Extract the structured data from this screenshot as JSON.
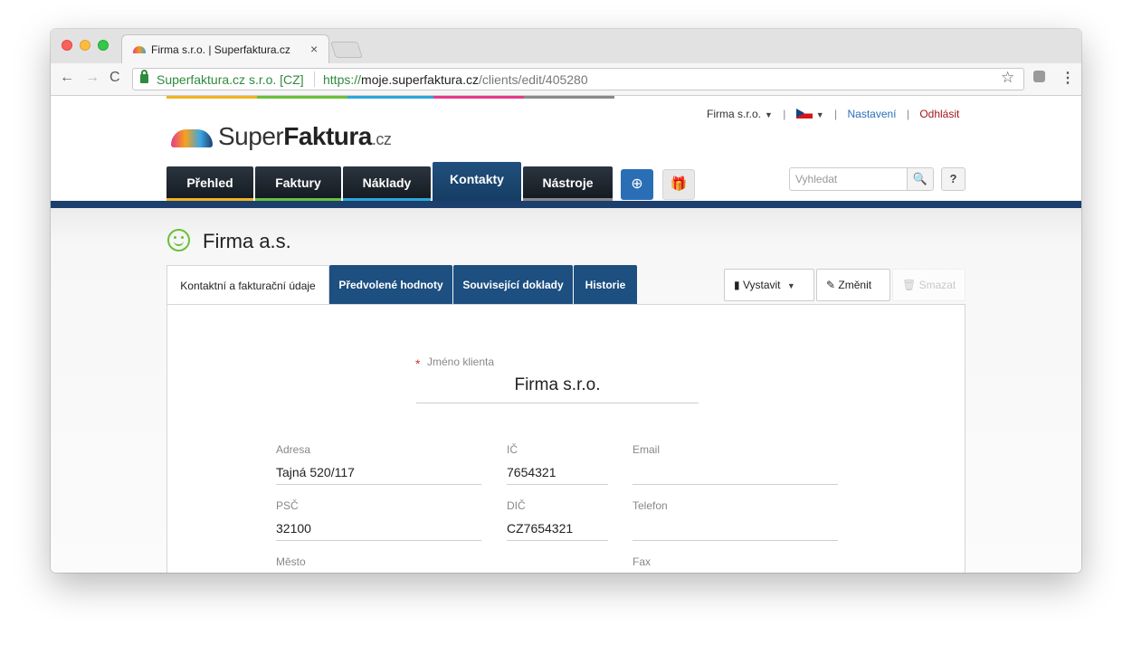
{
  "browser": {
    "tab_title": "Firma s.r.o. | Superfaktura.cz",
    "tab_close": "×",
    "ev_label": "Superfaktura.cz s.r.o. [CZ]",
    "url_scheme": "https://",
    "url_host": "moje.superfaktura.cz",
    "url_path": "/clients/edit/405280",
    "back": "←",
    "forward": "→",
    "reload": "C",
    "star": "☆",
    "menu": "⋮"
  },
  "logo": {
    "light": "Super",
    "bold": "Faktura",
    "tld": ".cz"
  },
  "userbar": {
    "company": "Firma s.r.o.",
    "settings": "Nastavení",
    "logout": "Odhlásit",
    "sep": "|",
    "caret": "▼"
  },
  "mainnav": {
    "items": [
      {
        "label": "Přehled",
        "bar_color": "#f0b323"
      },
      {
        "label": "Faktury",
        "bar_color": "#6bbf3a"
      },
      {
        "label": "Náklady",
        "bar_color": "#2aa8d8"
      },
      {
        "label": "Kontakty",
        "bar_color": "#1d4f80"
      },
      {
        "label": "Nástroje",
        "bar_color": "#8a8a8a"
      }
    ],
    "add_icon": "⊕",
    "gift_icon": "🎁"
  },
  "search": {
    "placeholder": "Vyhledat",
    "icon": "🔍",
    "help": "?"
  },
  "client": {
    "title": "Firma a.s."
  },
  "content_tabs": {
    "items": [
      "Kontaktní a fakturační údaje",
      "Předvolené hodnoty",
      "Související doklady",
      "Historie"
    ]
  },
  "actions": {
    "issue": "Vystavit",
    "edit": "Změnit",
    "delete": "Smazat",
    "caret": "▼",
    "edit_icon": "✎",
    "delete_icon": "🗑"
  },
  "form": {
    "required_mark": "*",
    "name_label": "Jméno klienta",
    "name_value": "Firma s.r.o.",
    "address_label": "Adresa",
    "address_value": "Tajná 520/117",
    "zip_label": "PSČ",
    "zip_value": "32100",
    "city_label": "Město",
    "ico_label": "IČ",
    "ico_value": "7654321",
    "dic_label": "DIČ",
    "dic_value": "CZ7654321",
    "email_label": "Email",
    "email_value": "",
    "phone_label": "Telefon",
    "phone_value": "",
    "fax_label": "Fax"
  },
  "colors": {
    "accent_blue": "#1d4f80",
    "nav_dark": "#1d3f6e",
    "link_blue": "#2a6fb6",
    "logout_red": "#a4161a",
    "smile_green": "#6bbf3a"
  }
}
